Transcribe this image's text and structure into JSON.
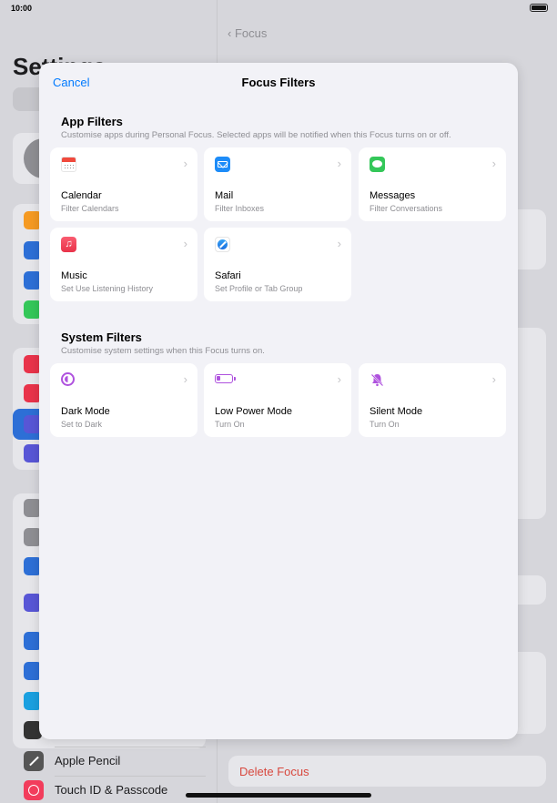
{
  "status_bar": {
    "time": "10:00"
  },
  "background": {
    "settings_title": "Settings",
    "back_label": "Focus",
    "bottom_rows": [
      {
        "label": "Apple Pencil"
      },
      {
        "label": "Touch ID & Passcode"
      }
    ],
    "delete_focus": "Delete Focus"
  },
  "sheet": {
    "cancel": "Cancel",
    "title": "Focus Filters",
    "app_filters": {
      "title": "App Filters",
      "subtitle": "Customise apps during Personal Focus. Selected apps will be notified when this Focus turns on or off.",
      "tiles": [
        {
          "name": "Calendar",
          "sub": "Filter Calendars",
          "icon": "calendar-icon"
        },
        {
          "name": "Mail",
          "sub": "Filter Inboxes",
          "icon": "mail-icon"
        },
        {
          "name": "Messages",
          "sub": "Filter Conversations",
          "icon": "messages-icon"
        },
        {
          "name": "Music",
          "sub": "Set Use Listening History",
          "icon": "music-icon"
        },
        {
          "name": "Safari",
          "sub": "Set Profile or Tab Group",
          "icon": "safari-icon"
        }
      ]
    },
    "system_filters": {
      "title": "System Filters",
      "subtitle": "Customise system settings when this Focus turns on.",
      "tiles": [
        {
          "name": "Dark Mode",
          "sub": "Set to Dark",
          "icon": "dark-mode-icon"
        },
        {
          "name": "Low Power Mode",
          "sub": "Turn On",
          "icon": "battery-icon"
        },
        {
          "name": "Silent Mode",
          "sub": "Turn On",
          "icon": "bell-slash-icon"
        }
      ]
    },
    "chevron": "›",
    "music_glyph": "♫",
    "bell_glyph": "🔔"
  },
  "colors": {
    "accent": "#007aff",
    "system_icon": "#af52de",
    "destructive": "#d8483e"
  }
}
